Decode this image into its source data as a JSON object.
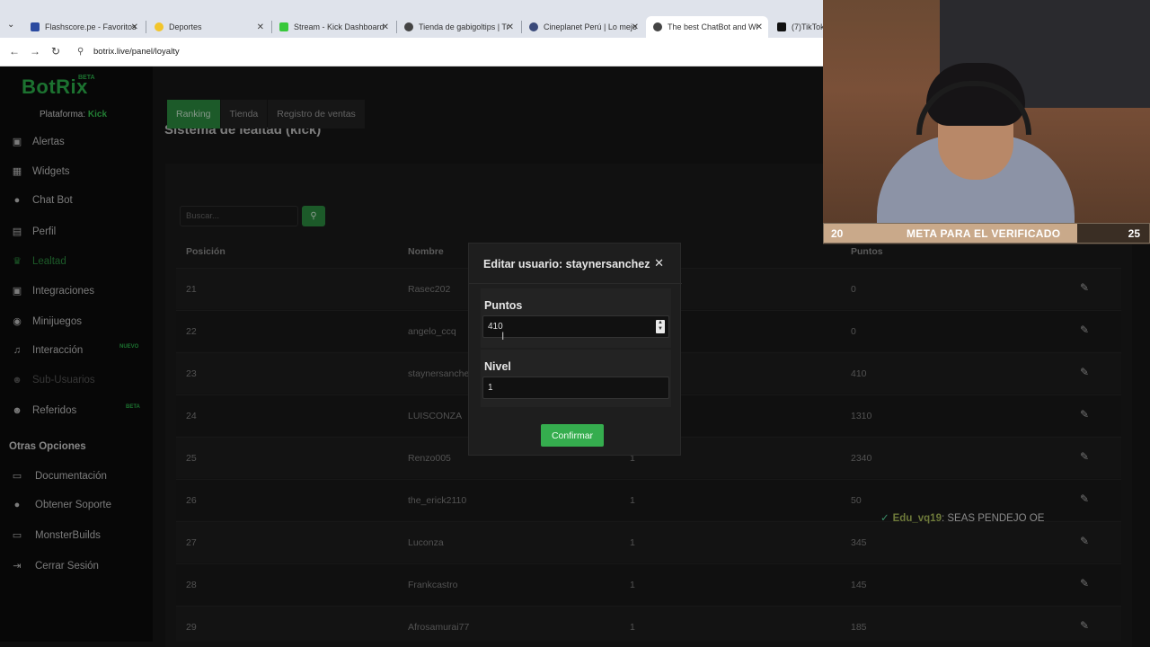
{
  "browser": {
    "tabs": [
      {
        "label": "Flashscore.pe - Favoritos",
        "fav": "#2b4aa0"
      },
      {
        "label": "Deportes",
        "fav": "#f2c52b"
      },
      {
        "label": "Stream - Kick Dashboard",
        "fav": "#38c83a"
      },
      {
        "label": "Tienda de gabigoltips | Tr",
        "fav": "#444444"
      },
      {
        "label": "Cineplanet Perú | Lo mejo",
        "fav": "#3b4a7a"
      },
      {
        "label": "The best ChatBot and Wi",
        "fav": "#444444"
      },
      {
        "label": "(7)TikTok -",
        "fav": "#111111"
      }
    ],
    "url": "botrix.live/panel/loyalty"
  },
  "sidebar": {
    "logo": "BotRix",
    "beta": "BETA",
    "platform_label": "Plataforma:",
    "platform_value": "Kick",
    "items": [
      {
        "label": "Alertas"
      },
      {
        "label": "Widgets"
      },
      {
        "label": "Chat Bot"
      },
      {
        "label": "Perfil"
      },
      {
        "label": "Lealtad"
      },
      {
        "label": "Integraciones"
      },
      {
        "label": "Minijuegos"
      },
      {
        "label": "Interacción"
      },
      {
        "label": "Sub-Usuarios"
      },
      {
        "label": "Referidos"
      }
    ],
    "section_title": "Otras Opciones",
    "options": [
      {
        "label": "Documentación"
      },
      {
        "label": "Obtener Soporte"
      },
      {
        "label": "MonsterBuilds"
      },
      {
        "label": "Cerrar Sesión"
      }
    ]
  },
  "main": {
    "title": "Sistema de lealtad (kick)",
    "tabs": [
      "Ranking",
      "Tienda",
      "Registro de ventas"
    ],
    "search_placeholder": "Buscar...",
    "columns": [
      "Posición",
      "Nombre",
      "Puntos"
    ],
    "rows": [
      {
        "pos": "21",
        "name": "Rasec202",
        "level": "",
        "points": "0"
      },
      {
        "pos": "22",
        "name": "angelo_ccq",
        "level": "",
        "points": "0"
      },
      {
        "pos": "23",
        "name": "staynersanche",
        "level": "",
        "points": "410"
      },
      {
        "pos": "24",
        "name": "LUISCONZA",
        "level": "",
        "points": "1310"
      },
      {
        "pos": "25",
        "name": "Renzo005",
        "level": "1",
        "points": "2340"
      },
      {
        "pos": "26",
        "name": "the_erick2110",
        "level": "1",
        "points": "50"
      },
      {
        "pos": "27",
        "name": "Luconza",
        "level": "1",
        "points": "345"
      },
      {
        "pos": "28",
        "name": "Frankcastro",
        "level": "1",
        "points": "145"
      },
      {
        "pos": "29",
        "name": "Afrosamurai77",
        "level": "1",
        "points": "185"
      }
    ]
  },
  "modal": {
    "title": "Editar usuario: staynersanchez",
    "points_label": "Puntos",
    "points_value": "410",
    "level_label": "Nivel",
    "level_value": "1",
    "confirm_label": "Confirmar"
  },
  "stream": {
    "goal_current": "20",
    "goal_text": "META PARA EL VERIFICADO",
    "goal_target": "25",
    "chat_user": "Edu_vq19",
    "chat_message": ": SEAS PENDEJO OE"
  },
  "colors": {
    "accent": "#2c8a40",
    "confirm": "#35ad4e"
  }
}
